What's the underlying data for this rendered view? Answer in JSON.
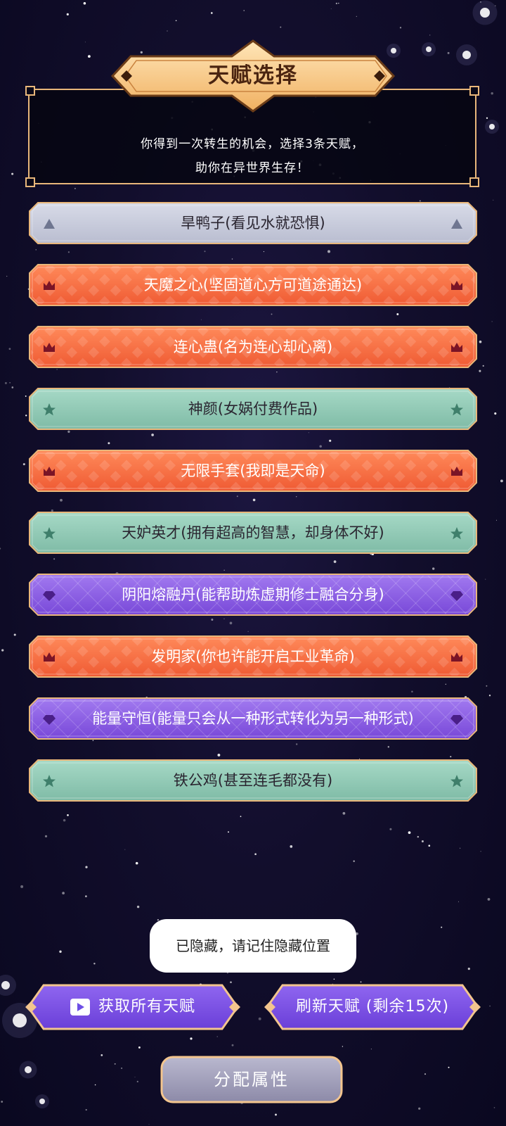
{
  "header": {
    "title": "天赋选择",
    "intro_line1": "你得到一次转生的机会，选择3条天赋，",
    "intro_line2": "助你在异世界生存！"
  },
  "talents": [
    {
      "label": "旱鸭子(看见水就恐惧)",
      "tier": "gray",
      "icon": "triangle-icon"
    },
    {
      "label": "天魔之心(坚固道心方可道途通达)",
      "tier": "red",
      "icon": "crown-icon"
    },
    {
      "label": "连心蛊(名为连心却心离)",
      "tier": "red",
      "icon": "crown-icon"
    },
    {
      "label": "神颜(女娲付费作品)",
      "tier": "teal",
      "icon": "star-icon"
    },
    {
      "label": "无限手套(我即是天命)",
      "tier": "red",
      "icon": "crown-icon"
    },
    {
      "label": "天妒英才(拥有超高的智慧，却身体不好)",
      "tier": "teal",
      "icon": "star-icon"
    },
    {
      "label": "阴阳熔融丹(能帮助炼虚期修士融合分身)",
      "tier": "purple",
      "icon": "diamond-icon"
    },
    {
      "label": "发明家(你也许能开启工业革命)",
      "tier": "red",
      "icon": "crown-icon"
    },
    {
      "label": "能量守恒(能量只会从一种形式转化为另一种形式)",
      "tier": "purple",
      "icon": "diamond-icon"
    },
    {
      "label": "铁公鸡(甚至连毛都没有)",
      "tier": "teal",
      "icon": "star-icon"
    }
  ],
  "toast": {
    "text": "已隐藏，请记住隐藏位置"
  },
  "buttons": {
    "get_all": "获取所有天赋",
    "refresh": "刷新天赋 (剩余15次)",
    "allocate": "分配属性"
  },
  "colors": {
    "gray": "#c5c9d8",
    "red": "#f4683f",
    "teal": "#8fc9b5",
    "purple": "#8a5ae0",
    "gold": "#f6c785",
    "frame": "#e8b67a"
  }
}
